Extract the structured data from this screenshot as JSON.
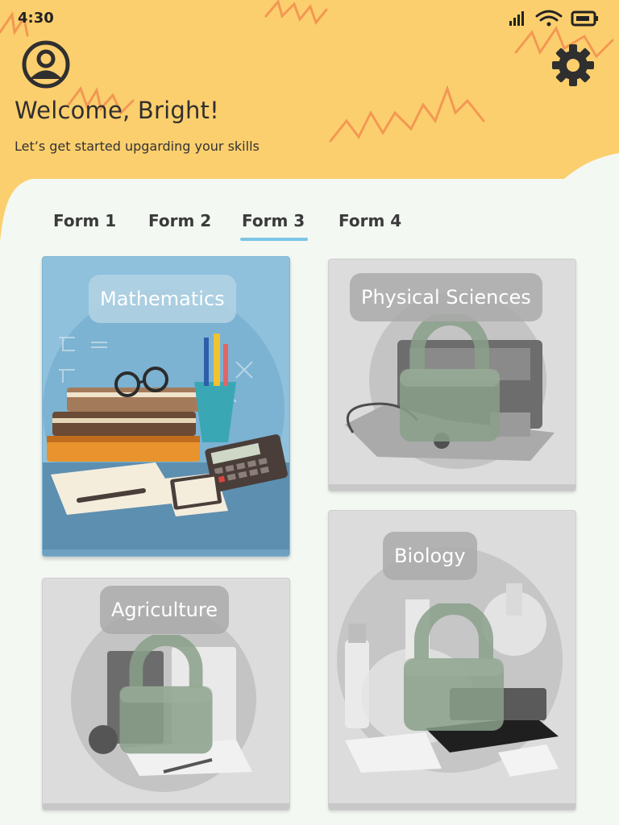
{
  "status_bar": {
    "time": "4:30",
    "icons": [
      "signal-icon",
      "wifi-icon",
      "battery-icon"
    ]
  },
  "header": {
    "avatar_icon": "user-avatar-icon",
    "settings_icon": "gear-icon",
    "welcome": "Welcome, Bright!",
    "subtitle": "Let’s get started upgarding your skills",
    "background_color": "#fccf6e"
  },
  "tabs": [
    {
      "label": "Form 1",
      "selected": false
    },
    {
      "label": "Form 2",
      "selected": false
    },
    {
      "label": "Form 3",
      "selected": true
    },
    {
      "label": "Form 4",
      "selected": false
    }
  ],
  "accent_color": "#7cc6e6",
  "subjects": [
    {
      "label": "Mathematics",
      "locked": false
    },
    {
      "label": "Physical Sciences",
      "locked": true
    },
    {
      "label": "Agriculture",
      "locked": true
    },
    {
      "label": "Biology",
      "locked": true
    }
  ]
}
